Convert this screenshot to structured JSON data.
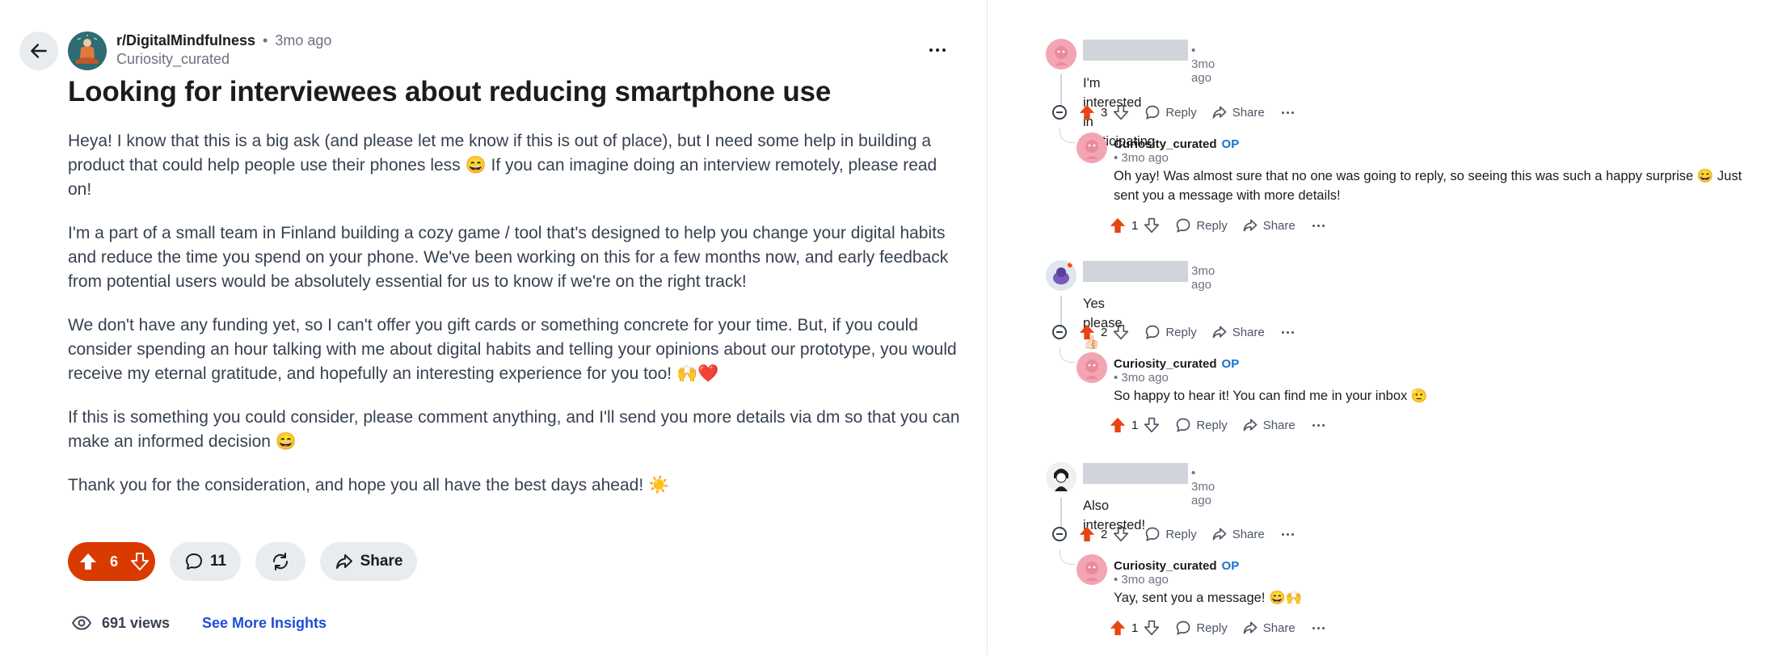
{
  "post": {
    "subreddit": "r/DigitalMindfulness",
    "separator": "•",
    "time": "3mo ago",
    "author": "Curiosity_curated",
    "title": "Looking for interviewees about reducing smartphone use",
    "paragraphs": [
      "Heya! I know that this is a big ask (and please let me know if this is out of place), but I need some help in building a product that could help people use their phones less 😄 If you can imagine doing an interview remotely, please read on!",
      "I'm a part of a small team in Finland building a cozy game / tool that's designed to help you change your digital habits and reduce the time you spend on your phone. We've been working on this for a few months now, and early feedback from potential users would be absolutely essential for us to know if we're on the right track!",
      "We don't have any funding yet, so I can't offer you gift cards or something concrete for your time. But, if you could consider spending an hour talking with me about digital habits and telling your opinions about our prototype, you would receive my eternal gratitude, and hopefully an interesting experience for you too! 🙌❤️",
      "If this is something you could consider, please comment anything, and I'll send you more details via dm so that you can make an informed decision 😄",
      "Thank you for the consideration, and hope you all have the best days ahead! ☀️"
    ],
    "votes": "6",
    "comments": "11",
    "share_label": "Share",
    "views": "691 views",
    "insights_label": "See More Insights",
    "icons": {
      "back": "arrow-left-icon",
      "more": "more-horizontal-icon",
      "upvote": "upvote-icon",
      "downvote": "downvote-icon",
      "comment": "comment-icon",
      "repost": "repost-icon",
      "share": "share-icon",
      "views": "eye-icon"
    },
    "accent_color": "#d93a00",
    "link_color": "#1d4ed8"
  },
  "comments": [
    {
      "time": "3mo ago",
      "text": "I'm interested in participating",
      "votes": "3",
      "reply_label": "Reply",
      "share_label": "Share",
      "reply": {
        "user": "Curiosity_curated",
        "op": "OP",
        "time": "3mo ago",
        "text": "Oh yay! Was almost sure that no one was going to reply, so seeing this was such a happy surprise 😄 Just sent you a message with more details!",
        "votes": "1",
        "reply_label": "Reply",
        "share_label": "Share"
      }
    },
    {
      "time": "3mo ago",
      "text": "Yes please 👍🏻",
      "votes": "2",
      "reply_label": "Reply",
      "share_label": "Share",
      "reply": {
        "user": "Curiosity_curated",
        "op": "OP",
        "time": "3mo ago",
        "text": "So happy to hear it! You can find me in your inbox 🫡",
        "votes": "1",
        "reply_label": "Reply",
        "share_label": "Share"
      }
    },
    {
      "time": "3mo ago",
      "text": "Also interested!",
      "votes": "2",
      "reply_label": "Reply",
      "share_label": "Share",
      "reply": {
        "user": "Curiosity_curated",
        "op": "OP",
        "time": "3mo ago",
        "text": "Yay, sent you a message! 😄🙌",
        "votes": "1",
        "reply_label": "Reply",
        "share_label": "Share"
      }
    }
  ]
}
